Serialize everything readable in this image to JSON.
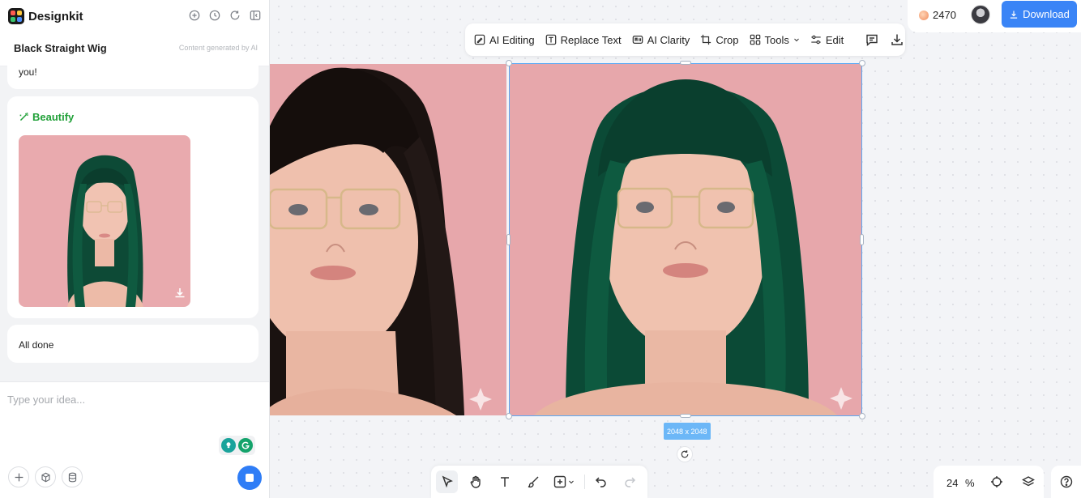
{
  "app": {
    "name": "Designkit",
    "header_icons": [
      "add-chat-icon",
      "history-icon",
      "refresh-icon",
      "collapse-panel-icon"
    ]
  },
  "conversation": {
    "title": "Black Straight Wig",
    "ai_note": "Content generated by AI",
    "messages": [
      {
        "text": "you!"
      },
      {
        "label": "Beautify",
        "icon": "magic-wand-icon"
      },
      {
        "text": "All done"
      }
    ]
  },
  "composer": {
    "placeholder": "Type your idea...",
    "tools": [
      "plus-icon",
      "cube-icon",
      "database-icon"
    ],
    "send_icon": "stop-icon"
  },
  "account": {
    "credits": "2470",
    "download_label": "Download"
  },
  "image_toolbar": {
    "items": [
      {
        "label": "AI Editing",
        "icon": "ai-edit-icon"
      },
      {
        "label": "Replace Text",
        "icon": "replace-text-icon"
      },
      {
        "label": "AI Clarity",
        "icon": "ai-clarity-icon"
      },
      {
        "label": "Crop",
        "icon": "crop-icon"
      },
      {
        "label": "Tools",
        "icon": "grid-icon"
      },
      {
        "label": "Edit",
        "icon": "sliders-icon"
      }
    ]
  },
  "canvas": {
    "size_label": "2048 x 2048",
    "zoom": "24",
    "zoom_unit": "%"
  },
  "colors": {
    "accent": "#3a84f6",
    "beautify_green": "#20a038",
    "selection": "#5aa9f5",
    "background_pink": "#e7a7ab"
  }
}
